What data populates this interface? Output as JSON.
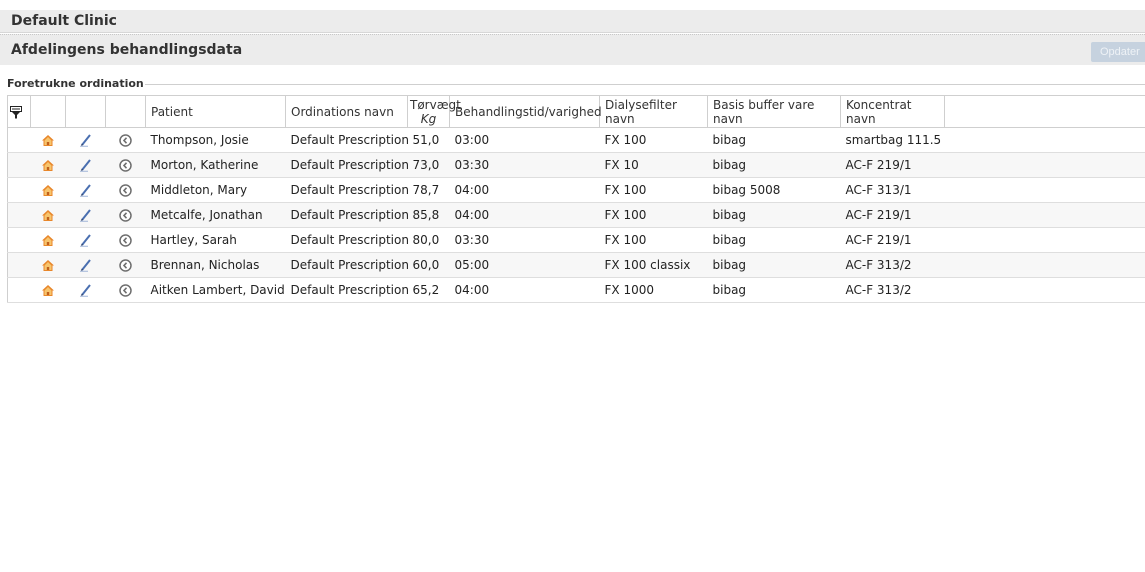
{
  "header": {
    "clinic_title": "Default Clinic",
    "department_title": "Afdelingens behandlingsdata",
    "update_button": "Opdater"
  },
  "section": {
    "label": "Foretrukne ordination"
  },
  "table": {
    "columns": {
      "patient": "Patient",
      "prescription": "Ordinations navn",
      "dry_weight": "Tørvægt",
      "dry_weight_unit": "Kg",
      "duration": "Behandlingstid/varighed",
      "dialyzer": "Dialysefilter navn",
      "buffer": "Basis buffer vare navn",
      "concentrate": "Koncentrat navn"
    },
    "rows": [
      {
        "patient": "Thompson, Josie",
        "prescription": "Default Prescription",
        "weight": "51,0",
        "duration": "03:00",
        "dialyzer": "FX 100",
        "buffer": "bibag",
        "concentrate": "smartbag 111.5"
      },
      {
        "patient": "Morton, Katherine",
        "prescription": "Default Prescription",
        "weight": "73,0",
        "duration": "03:30",
        "dialyzer": "FX 10",
        "buffer": "bibag",
        "concentrate": "AC-F 219/1"
      },
      {
        "patient": "Middleton, Mary",
        "prescription": "Default Prescription",
        "weight": "78,7",
        "duration": "04:00",
        "dialyzer": "FX 100",
        "buffer": "bibag 5008",
        "concentrate": "AC-F 313/1"
      },
      {
        "patient": "Metcalfe, Jonathan",
        "prescription": "Default Prescription",
        "weight": "85,8",
        "duration": "04:00",
        "dialyzer": "FX 100",
        "buffer": "bibag",
        "concentrate": "AC-F 219/1"
      },
      {
        "patient": "Hartley, Sarah",
        "prescription": "Default Prescription",
        "weight": "80,0",
        "duration": "03:30",
        "dialyzer": "FX 100",
        "buffer": "bibag",
        "concentrate": "AC-F 219/1"
      },
      {
        "patient": "Brennan, Nicholas",
        "prescription": "Default Prescription",
        "weight": "60,0",
        "duration": "05:00",
        "dialyzer": "FX 100 classix",
        "buffer": "bibag",
        "concentrate": "AC-F 313/2"
      },
      {
        "patient": "Aitken Lambert, David",
        "prescription": "Default Prescription",
        "weight": "65,2",
        "duration": "04:00",
        "dialyzer": "FX 1000",
        "buffer": "bibag",
        "concentrate": "AC-F 313/2"
      }
    ]
  },
  "icons": {
    "filter": "filter-icon",
    "home": "home-icon",
    "edit": "pen-icon",
    "history": "clock-icon"
  },
  "colors": {
    "home_orange": "#e8862a",
    "pen_blue": "#4a6fb0",
    "clock_gray": "#6e6e6e"
  }
}
